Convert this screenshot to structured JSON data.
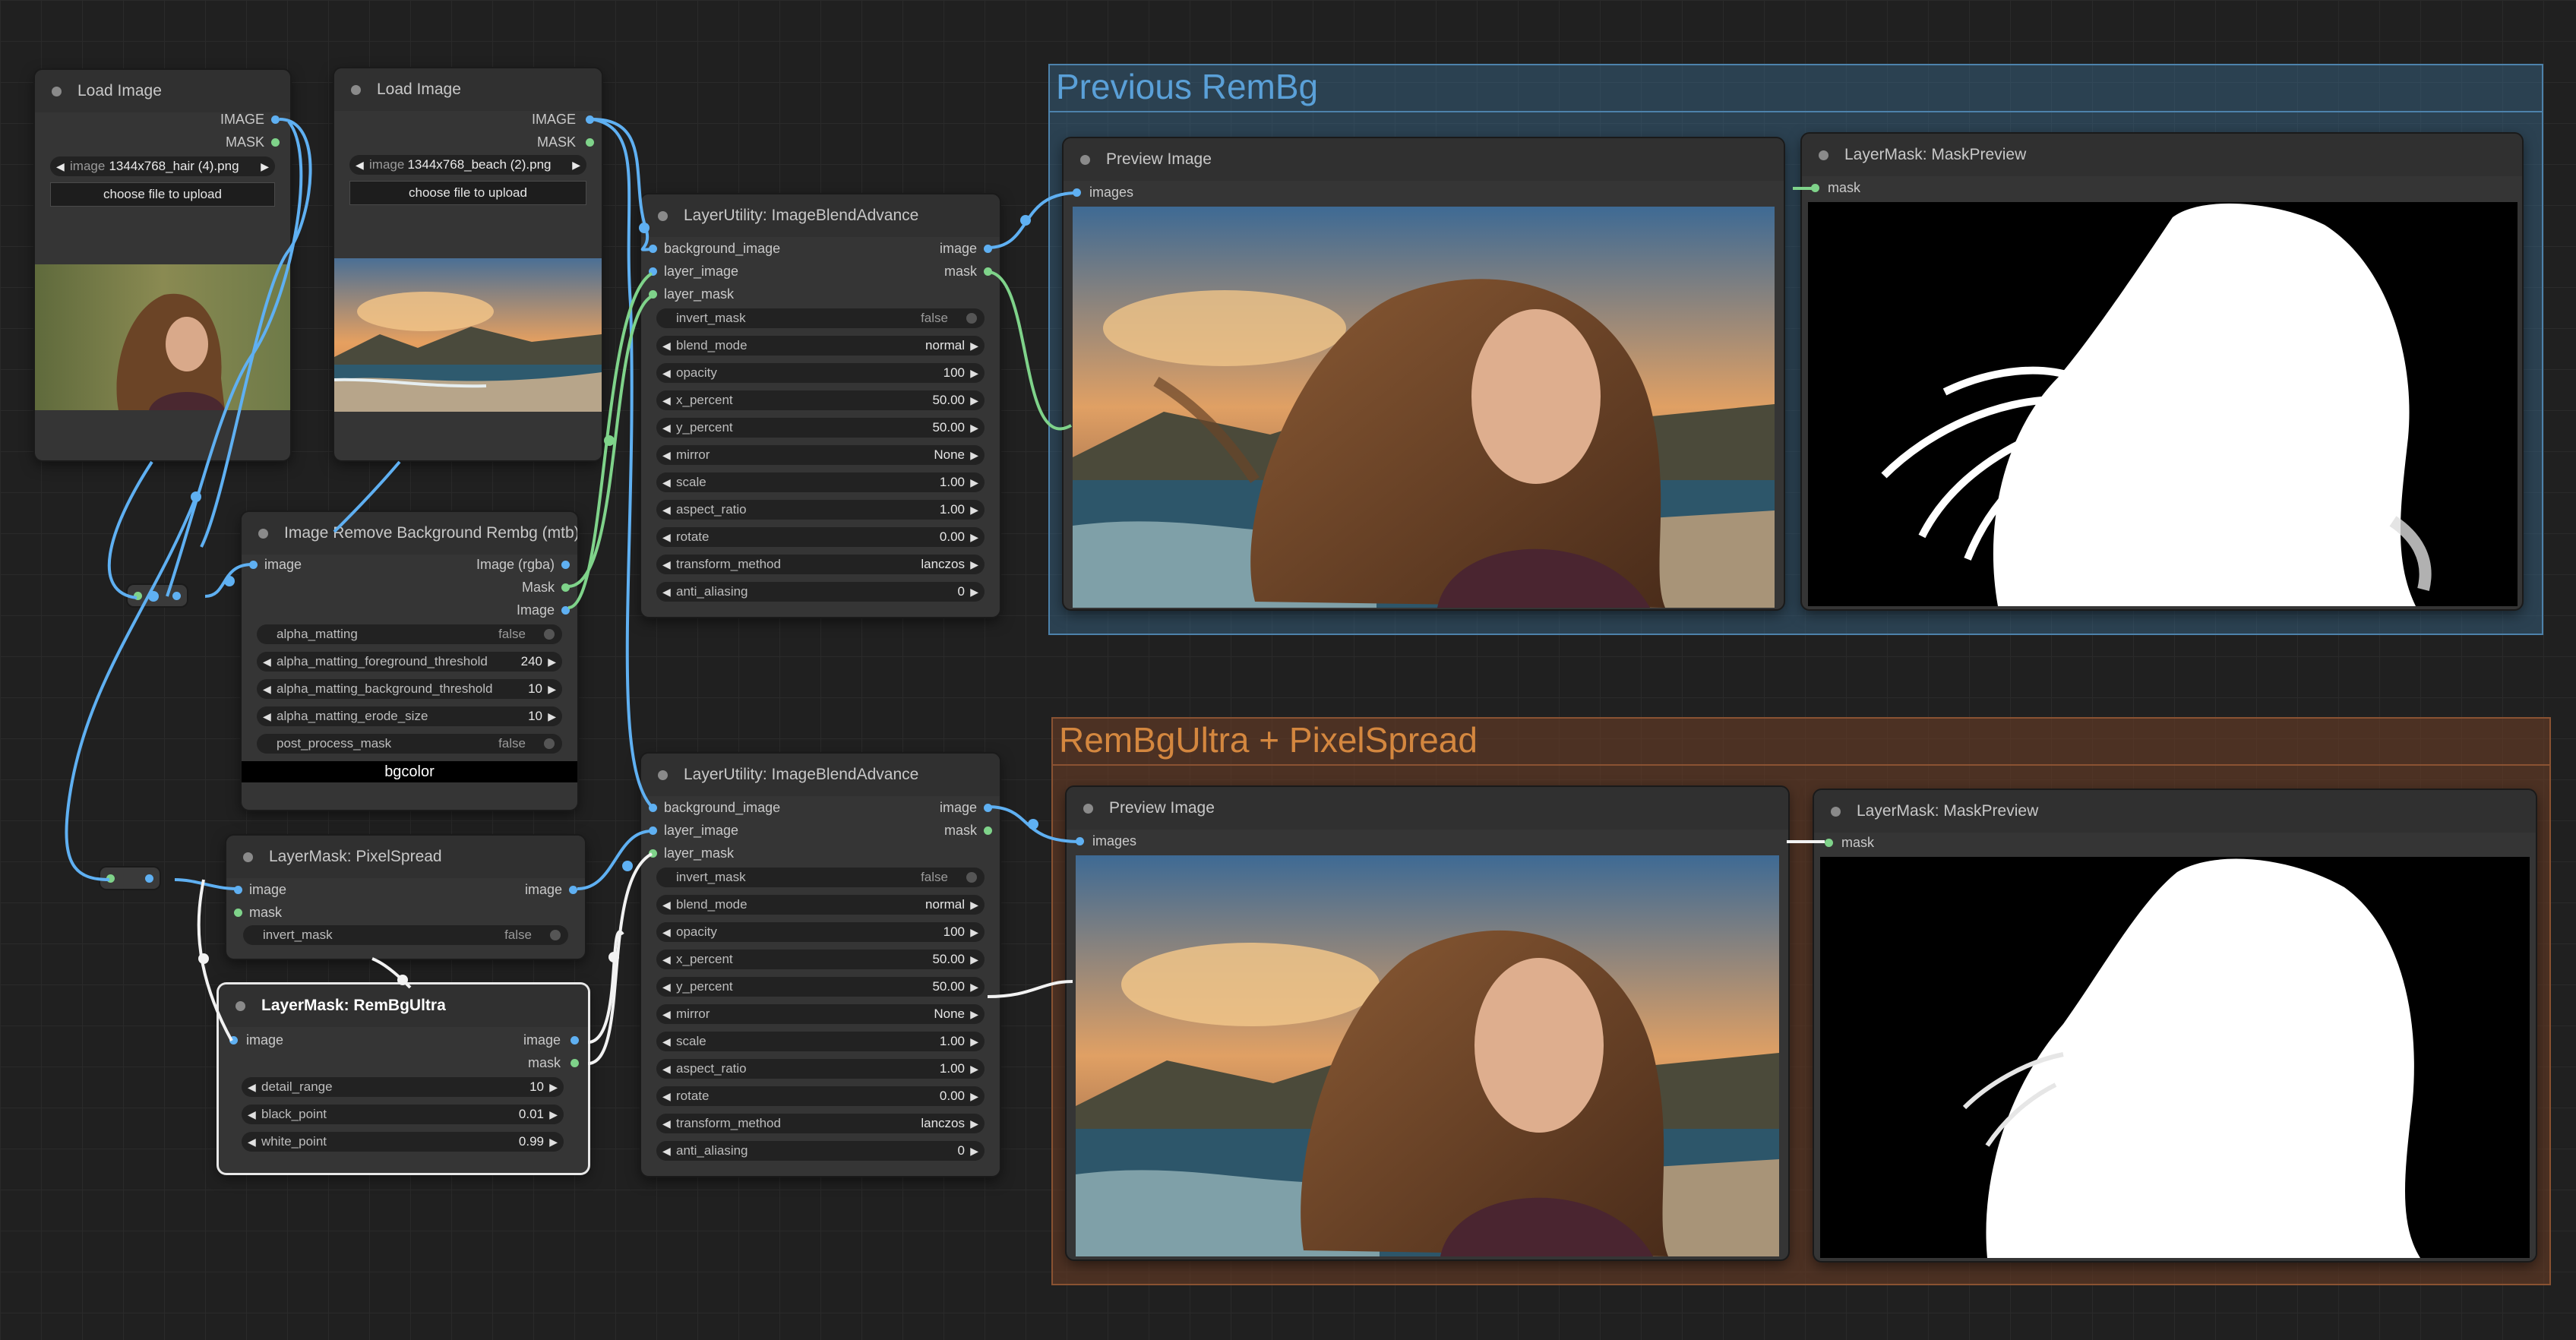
{
  "groups": {
    "previous": {
      "title": "Previous RemBg",
      "color": "#3a6b8f",
      "title_color": "#5aa0d8"
    },
    "ultra": {
      "title": "RemBgUltra + PixelSpread",
      "color": "#6b3d26",
      "title_color": "#d4873f"
    }
  },
  "load_hair": {
    "title": "Load Image",
    "out_image": "IMAGE",
    "out_mask": "MASK",
    "image_label": "image",
    "image_value": "1344x768_hair (4).png",
    "upload_label": "choose file to upload"
  },
  "load_beach": {
    "title": "Load Image",
    "out_image": "IMAGE",
    "out_mask": "MASK",
    "image_label": "image",
    "image_value": "1344x768_beach (2).png",
    "upload_label": "choose file to upload"
  },
  "rembg": {
    "title": "Image Remove Background Rembg (mtb)",
    "in_image": "image",
    "out_rgba": "Image (rgba)",
    "out_mask": "Mask",
    "out_image": "Image",
    "widgets": [
      {
        "label": "alpha_matting",
        "value": "false",
        "kind": "toggle"
      },
      {
        "label": "alpha_matting_foreground_threshold",
        "value": "240",
        "kind": "number"
      },
      {
        "label": "alpha_matting_background_threshold",
        "value": "10",
        "kind": "number"
      },
      {
        "label": "alpha_matting_erode_size",
        "value": "10",
        "kind": "number"
      },
      {
        "label": "post_process_mask",
        "value": "false",
        "kind": "toggle"
      }
    ],
    "bgcolor_label": "bgcolor"
  },
  "pixelspread": {
    "title": "LayerMask: PixelSpread",
    "in_image": "image",
    "in_mask": "mask",
    "out_image": "image",
    "invert_label": "invert_mask",
    "invert_value": "false"
  },
  "rembgultra": {
    "title": "LayerMask: RemBgUltra",
    "in_image": "image",
    "out_image": "image",
    "out_mask": "mask",
    "widgets": [
      {
        "label": "detail_range",
        "value": "10"
      },
      {
        "label": "black_point",
        "value": "0.01"
      },
      {
        "label": "white_point",
        "value": "0.99"
      }
    ]
  },
  "blend1": {
    "title": "LayerUtility: ImageBlendAdvance",
    "in_bg": "background_image",
    "in_layer": "layer_image",
    "in_mask": "layer_mask",
    "out_image": "image",
    "out_mask": "mask",
    "widgets": [
      {
        "label": "invert_mask",
        "value": "false",
        "kind": "toggle"
      },
      {
        "label": "blend_mode",
        "value": "normal",
        "kind": "number"
      },
      {
        "label": "opacity",
        "value": "100",
        "kind": "number"
      },
      {
        "label": "x_percent",
        "value": "50.00",
        "kind": "number"
      },
      {
        "label": "y_percent",
        "value": "50.00",
        "kind": "number"
      },
      {
        "label": "mirror",
        "value": "None",
        "kind": "number"
      },
      {
        "label": "scale",
        "value": "1.00",
        "kind": "number"
      },
      {
        "label": "aspect_ratio",
        "value": "1.00",
        "kind": "number"
      },
      {
        "label": "rotate",
        "value": "0.00",
        "kind": "number"
      },
      {
        "label": "transform_method",
        "value": "lanczos",
        "kind": "number"
      },
      {
        "label": "anti_aliasing",
        "value": "0",
        "kind": "number"
      }
    ]
  },
  "blend2": {
    "title": "LayerUtility: ImageBlendAdvance",
    "in_bg": "background_image",
    "in_layer": "layer_image",
    "in_mask": "layer_mask",
    "out_image": "image",
    "out_mask": "mask",
    "widgets": [
      {
        "label": "invert_mask",
        "value": "false",
        "kind": "toggle"
      },
      {
        "label": "blend_mode",
        "value": "normal",
        "kind": "number"
      },
      {
        "label": "opacity",
        "value": "100",
        "kind": "number"
      },
      {
        "label": "x_percent",
        "value": "50.00",
        "kind": "number"
      },
      {
        "label": "y_percent",
        "value": "50.00",
        "kind": "number"
      },
      {
        "label": "mirror",
        "value": "None",
        "kind": "number"
      },
      {
        "label": "scale",
        "value": "1.00",
        "kind": "number"
      },
      {
        "label": "aspect_ratio",
        "value": "1.00",
        "kind": "number"
      },
      {
        "label": "rotate",
        "value": "0.00",
        "kind": "number"
      },
      {
        "label": "transform_method",
        "value": "lanczos",
        "kind": "number"
      },
      {
        "label": "anti_aliasing",
        "value": "0",
        "kind": "number"
      }
    ]
  },
  "preview1": {
    "title": "Preview Image",
    "in_images": "images"
  },
  "maskprev1": {
    "title": "LayerMask: MaskPreview",
    "in_mask": "mask"
  },
  "preview2": {
    "title": "Preview Image",
    "in_images": "images"
  },
  "maskprev2": {
    "title": "LayerMask: MaskPreview",
    "in_mask": "mask"
  },
  "colors": {
    "image_wire": "#5fb0f2",
    "mask_wire": "#7fd38a",
    "white_wire": "#f2f2f2"
  }
}
